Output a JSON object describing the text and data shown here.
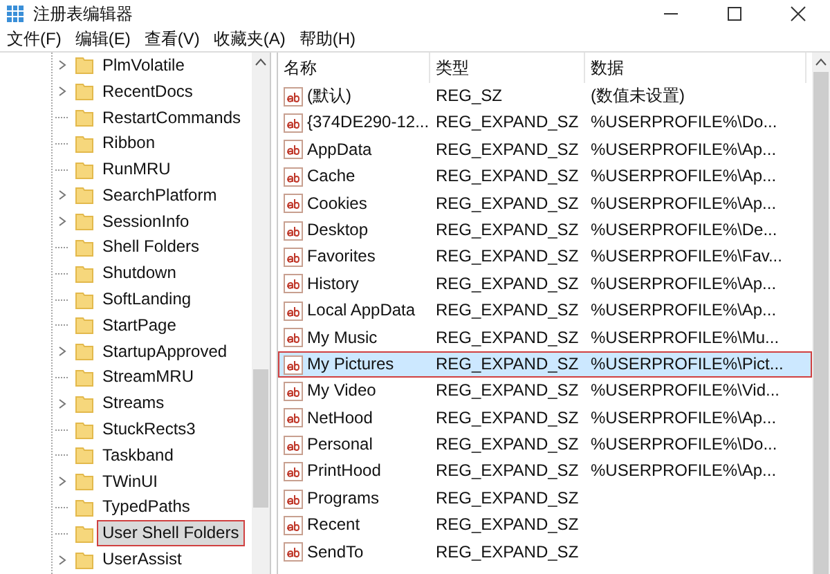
{
  "window": {
    "title": "注册表编辑器"
  },
  "menu": [
    "文件(F)",
    "编辑(E)",
    "查看(V)",
    "收藏夹(A)",
    "帮助(H)"
  ],
  "tree": {
    "items": [
      {
        "label": "PlmVolatile",
        "expandable": true,
        "selected": false
      },
      {
        "label": "RecentDocs",
        "expandable": true,
        "selected": false
      },
      {
        "label": "RestartCommands",
        "expandable": false,
        "selected": false
      },
      {
        "label": "Ribbon",
        "expandable": false,
        "selected": false
      },
      {
        "label": "RunMRU",
        "expandable": false,
        "selected": false
      },
      {
        "label": "SearchPlatform",
        "expandable": true,
        "selected": false
      },
      {
        "label": "SessionInfo",
        "expandable": true,
        "selected": false
      },
      {
        "label": "Shell Folders",
        "expandable": false,
        "selected": false
      },
      {
        "label": "Shutdown",
        "expandable": false,
        "selected": false
      },
      {
        "label": "SoftLanding",
        "expandable": false,
        "selected": false
      },
      {
        "label": "StartPage",
        "expandable": false,
        "selected": false
      },
      {
        "label": "StartupApproved",
        "expandable": true,
        "selected": false
      },
      {
        "label": "StreamMRU",
        "expandable": false,
        "selected": false
      },
      {
        "label": "Streams",
        "expandable": true,
        "selected": false
      },
      {
        "label": "StuckRects3",
        "expandable": false,
        "selected": false
      },
      {
        "label": "Taskband",
        "expandable": false,
        "selected": false
      },
      {
        "label": "TWinUI",
        "expandable": true,
        "selected": false
      },
      {
        "label": "TypedPaths",
        "expandable": false,
        "selected": false
      },
      {
        "label": "User Shell Folders",
        "expandable": false,
        "selected": true
      },
      {
        "label": "UserAssist",
        "expandable": true,
        "selected": false
      }
    ]
  },
  "table": {
    "columns": [
      "名称",
      "类型",
      "数据"
    ],
    "rows": [
      {
        "name": "(默认)",
        "type": "REG_SZ",
        "data": "(数值未设置)",
        "selected": false
      },
      {
        "name": "{374DE290-12...",
        "type": "REG_EXPAND_SZ",
        "data": "%USERPROFILE%\\Do...",
        "selected": false
      },
      {
        "name": "AppData",
        "type": "REG_EXPAND_SZ",
        "data": "%USERPROFILE%\\Ap...",
        "selected": false
      },
      {
        "name": "Cache",
        "type": "REG_EXPAND_SZ",
        "data": "%USERPROFILE%\\Ap...",
        "selected": false
      },
      {
        "name": "Cookies",
        "type": "REG_EXPAND_SZ",
        "data": "%USERPROFILE%\\Ap...",
        "selected": false
      },
      {
        "name": "Desktop",
        "type": "REG_EXPAND_SZ",
        "data": "%USERPROFILE%\\De...",
        "selected": false
      },
      {
        "name": "Favorites",
        "type": "REG_EXPAND_SZ",
        "data": "%USERPROFILE%\\Fav...",
        "selected": false
      },
      {
        "name": "History",
        "type": "REG_EXPAND_SZ",
        "data": "%USERPROFILE%\\Ap...",
        "selected": false
      },
      {
        "name": "Local AppData",
        "type": "REG_EXPAND_SZ",
        "data": "%USERPROFILE%\\Ap...",
        "selected": false
      },
      {
        "name": "My Music",
        "type": "REG_EXPAND_SZ",
        "data": "%USERPROFILE%\\Mu...",
        "selected": false
      },
      {
        "name": "My Pictures",
        "type": "REG_EXPAND_SZ",
        "data": "%USERPROFILE%\\Pict...",
        "selected": true
      },
      {
        "name": "My Video",
        "type": "REG_EXPAND_SZ",
        "data": "%USERPROFILE%\\Vid...",
        "selected": false
      },
      {
        "name": "NetHood",
        "type": "REG_EXPAND_SZ",
        "data": "%USERPROFILE%\\Ap...",
        "selected": false
      },
      {
        "name": "Personal",
        "type": "REG_EXPAND_SZ",
        "data": "%USERPROFILE%\\Do...",
        "selected": false
      },
      {
        "name": "PrintHood",
        "type": "REG_EXPAND_SZ",
        "data": "%USERPROFILE%\\Ap...",
        "selected": false
      },
      {
        "name": "Programs",
        "type": "REG_EXPAND_SZ",
        "selected": false
      },
      {
        "name": "Recent",
        "type": "REG_EXPAND_SZ",
        "selected": false
      },
      {
        "name": "SendTo",
        "type": "REG_EXPAND_SZ",
        "selected": false
      }
    ]
  }
}
